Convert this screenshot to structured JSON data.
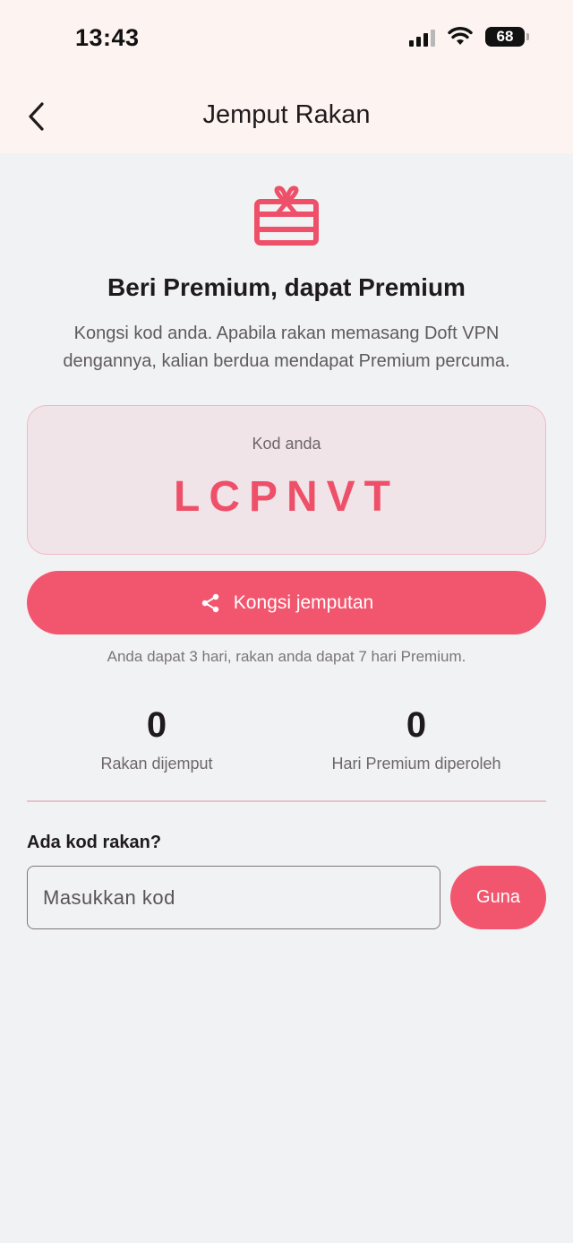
{
  "status_bar": {
    "time": "13:43",
    "battery": "68"
  },
  "header": {
    "title": "Jemput Rakan"
  },
  "hero": {
    "headline": "Beri Premium, dapat Premium",
    "subtitle": "Kongsi kod anda. Apabila rakan memasang Doft VPN dengannya, kalian berdua mendapat Premium percuma."
  },
  "code_card": {
    "label": "Kod anda",
    "code": "LCPNVT"
  },
  "share_button": {
    "label": "Kongsi jemputan"
  },
  "reward_note": "Anda dapat 3 hari, rakan anda dapat 7 hari Premium.",
  "stats": [
    {
      "value": "0",
      "caption": "Rakan dijemput"
    },
    {
      "value": "0",
      "caption": "Hari Premium diperoleh"
    }
  ],
  "redeem": {
    "label": "Ada kod rakan?",
    "placeholder": "Masukkan kod",
    "value": "",
    "button_label": "Guna"
  },
  "colors": {
    "accent": "#f2566e",
    "card_bg": "#f1e4e8",
    "page_bg": "#f1f2f4",
    "header_bg": "#fdf3f1"
  }
}
